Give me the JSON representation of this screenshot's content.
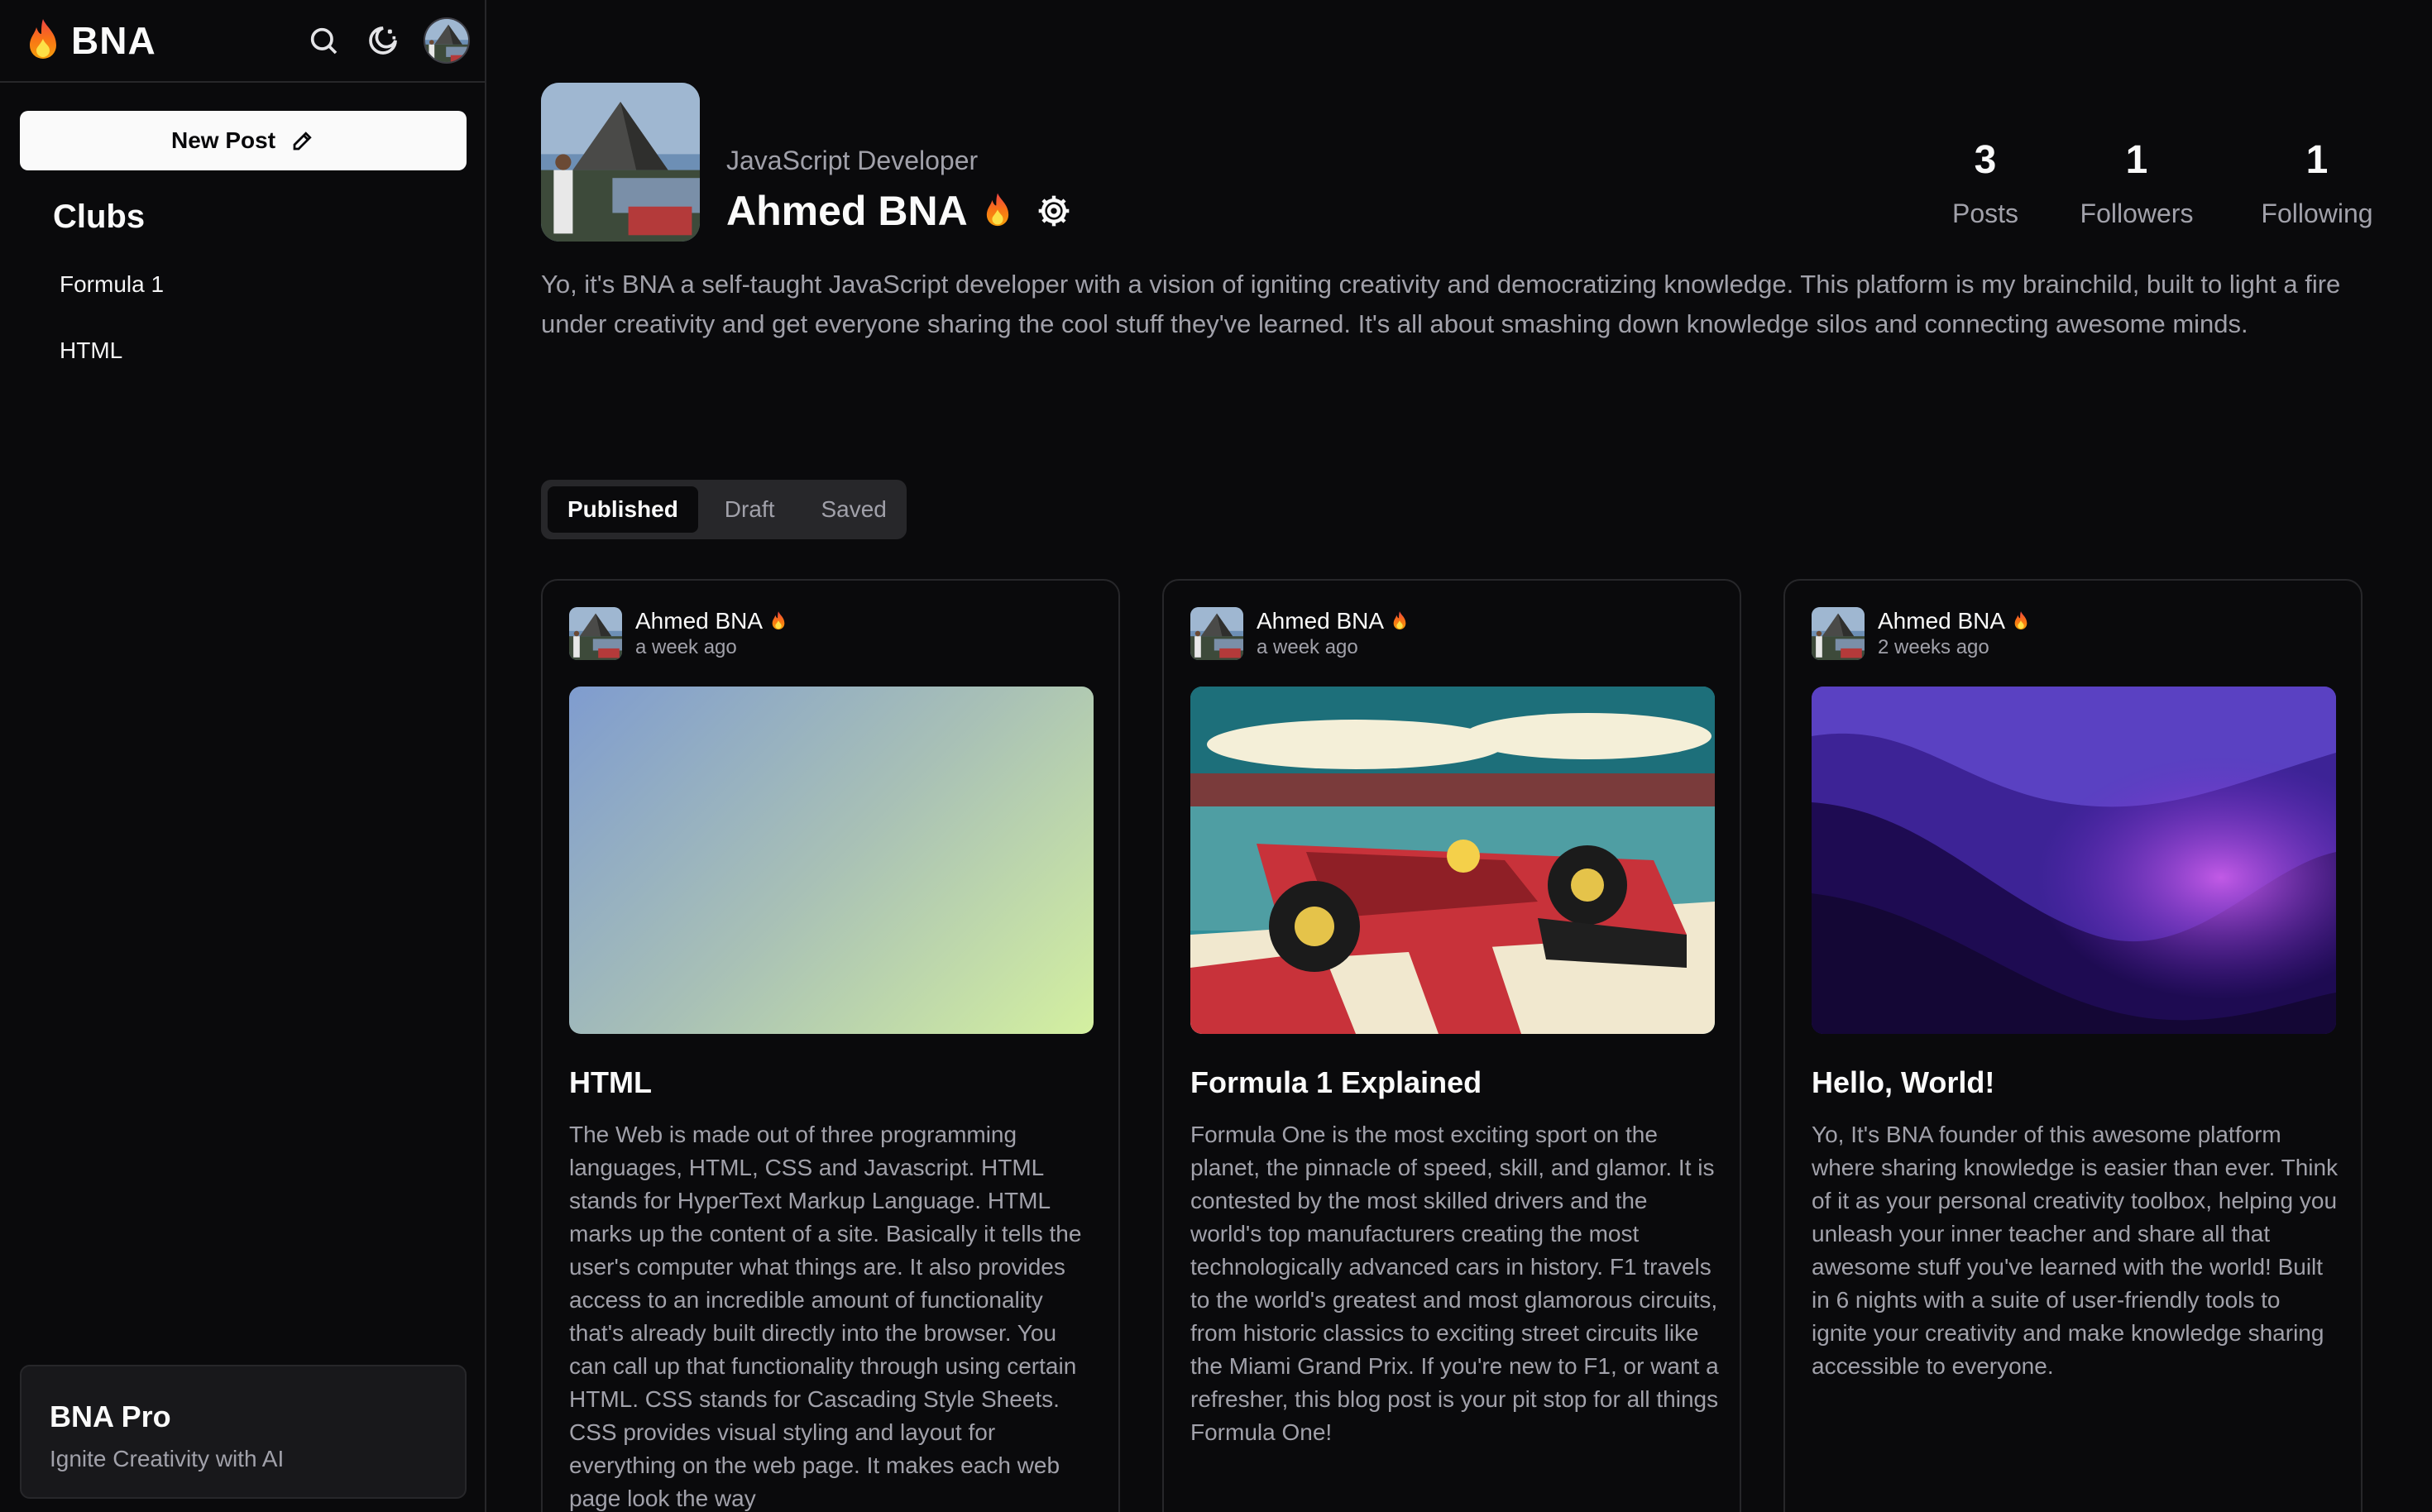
{
  "app": {
    "name": "BNA"
  },
  "sidebar": {
    "new_post_label": "New Post",
    "clubs_title": "Clubs",
    "clubs": [
      {
        "label": "Formula 1"
      },
      {
        "label": "HTML"
      }
    ],
    "pro": {
      "title": "BNA Pro",
      "subtitle": "Ignite Creativity with AI"
    }
  },
  "profile": {
    "role": "JavaScript Developer",
    "name": "Ahmed BNA",
    "stats": [
      {
        "value": "3",
        "label": "Posts"
      },
      {
        "value": "1",
        "label": "Followers"
      },
      {
        "value": "1",
        "label": "Following"
      }
    ],
    "bio": "Yo, it's BNA a self-taught JavaScript developer with a vision of igniting creativity and democratizing knowledge. This platform is my brainchild, built to light a fire under creativity and get everyone sharing the cool stuff they've learned. It's all about smashing down knowledge silos and connecting awesome minds."
  },
  "tabs": [
    {
      "label": "Published",
      "active": true
    },
    {
      "label": "Draft",
      "active": false
    },
    {
      "label": "Saved",
      "active": false
    }
  ],
  "posts": [
    {
      "author": "Ahmed BNA",
      "time": "a week ago",
      "title": "HTML",
      "body": "The Web is made out of three programming languages, HTML, CSS and Javascript. HTML stands for HyperText Markup Language. HTML marks up the content of a site. Basically it tells the user's computer what things are. It also provides access to an incredible amount of functionality that's already built directly into the browser. You can call up that functionality through using certain HTML. CSS stands for Cascading Style Sheets. CSS provides visual styling and layout for everything on the web page. It makes each web page look the way"
    },
    {
      "author": "Ahmed BNA",
      "time": "a week ago",
      "title": "Formula 1 Explained",
      "body": "Formula One is the most exciting sport on the planet, the pinnacle of speed, skill, and glamor. It is contested by the most skilled drivers and the world's top manufacturers creating the most technologically advanced cars in history. F1 travels to the world's greatest and most glamorous circuits, from historic classics to exciting street circuits like the Miami Grand Prix. If you're new to F1, or want a refresher, this blog post is your pit stop for all things Formula One!"
    },
    {
      "author": "Ahmed BNA",
      "time": "2 weeks ago",
      "title": "Hello, World!",
      "body": "Yo, It's BNA founder of this awesome platform where sharing knowledge is easier than ever. Think of it as your personal creativity toolbox, helping you unleash your inner teacher and share all that awesome stuff you've learned with the world! Built in 6 nights with a suite of user-friendly tools to ignite your creativity and make knowledge sharing accessible to everyone."
    }
  ],
  "icons": {
    "logo": "flame-icon",
    "search": "search-icon",
    "theme": "moon-stars-icon",
    "settings": "gear-icon",
    "new_post": "pencil-icon"
  },
  "colors": {
    "background": "#0a0a0c",
    "primary_button": "#fafafa",
    "muted_text": "#a1a1aa",
    "border": "#27272a",
    "flame": "#f97316"
  }
}
